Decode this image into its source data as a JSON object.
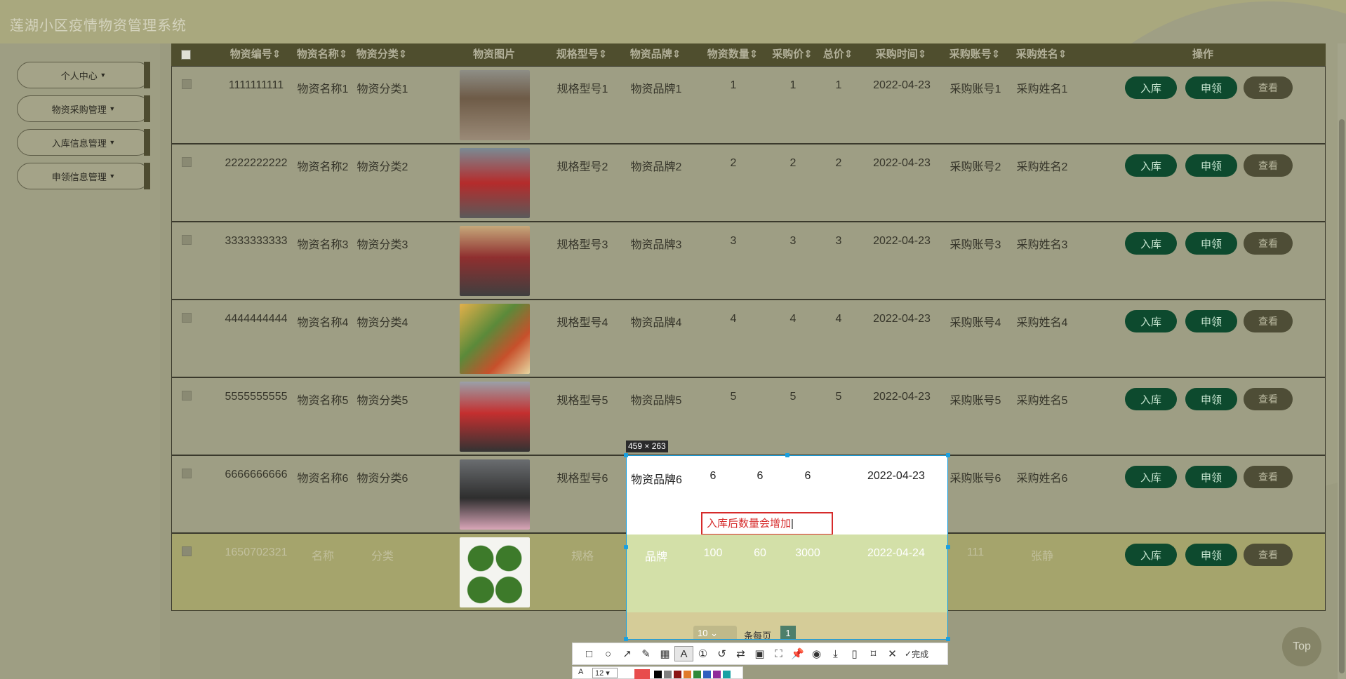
{
  "app": {
    "title": "莲湖小区疫情物资管理系统"
  },
  "sidebar": {
    "items": [
      {
        "label": "个人中心"
      },
      {
        "label": "物资采购管理"
      },
      {
        "label": "入库信息管理"
      },
      {
        "label": "申领信息管理"
      }
    ]
  },
  "table": {
    "headers": [
      "物资编号",
      "物资名称",
      "物资分类",
      "物资图片",
      "规格型号",
      "物资品牌",
      "物资数量",
      "采购价",
      "总价",
      "采购时间",
      "采购账号",
      "采购姓名",
      "操作"
    ],
    "rows": [
      {
        "code": "1111111111",
        "name": "物资名称1",
        "category": "物资分类1",
        "spec": "规格型号1",
        "brand": "物资品牌1",
        "qty": "1",
        "price": "1",
        "total": "1",
        "date": "2022-04-23",
        "account": "采购账号1",
        "buyer": "采购姓名1"
      },
      {
        "code": "2222222222",
        "name": "物资名称2",
        "category": "物资分类2",
        "spec": "规格型号2",
        "brand": "物资品牌2",
        "qty": "2",
        "price": "2",
        "total": "2",
        "date": "2022-04-23",
        "account": "采购账号2",
        "buyer": "采购姓名2"
      },
      {
        "code": "3333333333",
        "name": "物资名称3",
        "category": "物资分类3",
        "spec": "规格型号3",
        "brand": "物资品牌3",
        "qty": "3",
        "price": "3",
        "total": "3",
        "date": "2022-04-23",
        "account": "采购账号3",
        "buyer": "采购姓名3"
      },
      {
        "code": "4444444444",
        "name": "物资名称4",
        "category": "物资分类4",
        "spec": "规格型号4",
        "brand": "物资品牌4",
        "qty": "4",
        "price": "4",
        "total": "4",
        "date": "2022-04-23",
        "account": "采购账号4",
        "buyer": "采购姓名4"
      },
      {
        "code": "5555555555",
        "name": "物资名称5",
        "category": "物资分类5",
        "spec": "规格型号5",
        "brand": "物资品牌5",
        "qty": "5",
        "price": "5",
        "total": "5",
        "date": "2022-04-23",
        "account": "采购账号5",
        "buyer": "采购姓名5"
      },
      {
        "code": "6666666666",
        "name": "物资名称6",
        "category": "物资分类6",
        "spec": "规格型号6",
        "brand": "物资品牌6",
        "qty": "6",
        "price": "6",
        "total": "6",
        "date": "2022-04-23",
        "account": "采购账号6",
        "buyer": "采购姓名6"
      },
      {
        "code": "1650702321",
        "name": "名称",
        "category": "分类",
        "spec": "规格",
        "brand": "品牌",
        "qty": "100",
        "price": "60",
        "total": "3000",
        "date": "2022-04-24",
        "account": "111",
        "buyer": "张静"
      }
    ],
    "actions": {
      "stock_in": "入库",
      "apply": "申领",
      "view": "查看"
    }
  },
  "pagination": {
    "page_size": "10",
    "per_page_label": "条每页",
    "current_page": "1"
  },
  "screenshot_tool": {
    "dimensions": "459 × 263",
    "annotation_text": "入库后数量会增加",
    "done_label": "完成",
    "font_size": "12",
    "colors": [
      "#e84c4c",
      "#000000",
      "#7f7f7f",
      "#8b1414",
      "#e07b2a",
      "#2e8b3a",
      "#2d5fbf",
      "#8e2a9a",
      "#17a2a4"
    ]
  },
  "top_button": {
    "label": "Top"
  }
}
